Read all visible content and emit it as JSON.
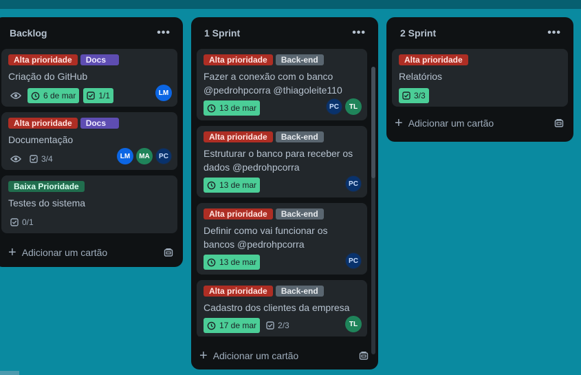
{
  "lists": [
    {
      "title": "Backlog",
      "menu": "•••",
      "add_card": "Adicionar um cartão",
      "cards": [
        {
          "labels": [
            {
              "text": "Alta prioridade",
              "color": "red"
            },
            {
              "text": "Docs",
              "color": "purple"
            }
          ],
          "title": "Criação do GitHub",
          "watch": true,
          "date": "6 de mar",
          "checklist": "1/1",
          "avatars": [
            "LM"
          ]
        },
        {
          "labels": [
            {
              "text": "Alta prioridade",
              "color": "red"
            },
            {
              "text": "Docs",
              "color": "purple"
            }
          ],
          "title": "Documentação",
          "watch": true,
          "checklist": "3/4",
          "avatars": [
            "LM",
            "MA",
            "PC"
          ]
        },
        {
          "labels": [
            {
              "text": "Baixa Prioridade",
              "color": "green"
            }
          ],
          "title": "Testes do sistema",
          "checklist": "0/1"
        }
      ]
    },
    {
      "title": "1 Sprint",
      "menu": "•••",
      "add_card": "Adicionar um cartão",
      "cards": [
        {
          "labels": [
            {
              "text": "Alta prioridade",
              "color": "red"
            },
            {
              "text": "Back-end",
              "color": "gray"
            }
          ],
          "title_lines": [
            "Fazer a conexão com o banco",
            "@pedrohpcorra @thiagoleite110"
          ],
          "date": "13 de mar",
          "avatars": [
            "PC",
            "TL"
          ]
        },
        {
          "labels": [
            {
              "text": "Alta prioridade",
              "color": "red"
            },
            {
              "text": "Back-end",
              "color": "gray"
            }
          ],
          "title_lines": [
            "Estruturar o banco para receber os",
            "dados @pedrohpcorra"
          ],
          "date": "13 de mar",
          "avatars": [
            "PC"
          ]
        },
        {
          "labels": [
            {
              "text": "Alta prioridade",
              "color": "red"
            },
            {
              "text": "Back-end",
              "color": "gray"
            }
          ],
          "title_lines": [
            "Definir como vai funcionar os",
            "bancos @pedrohpcorra"
          ],
          "date": "13 de mar",
          "avatars": [
            "PC"
          ]
        },
        {
          "labels": [
            {
              "text": "Alta prioridade",
              "color": "red"
            },
            {
              "text": "Back-end",
              "color": "gray"
            }
          ],
          "title_lines": [
            "Cadastro dos clientes da empresa"
          ],
          "date": "17 de mar",
          "checklist": "2/3",
          "avatars": [
            "TL"
          ]
        }
      ]
    },
    {
      "title": "2 Sprint",
      "menu": "•••",
      "add_card": "Adicionar um cartão",
      "cards": [
        {
          "labels": [
            {
              "text": "Alta prioridade",
              "color": "red"
            }
          ],
          "title": "Relatórios",
          "checklist": "3/3"
        }
      ]
    }
  ],
  "colors": {
    "board_bg": "#0a8aa0",
    "list_bg": "#0f1214",
    "card_bg": "#22272b",
    "badge_done": "#4bce97",
    "label_red": "#ae2e24",
    "label_purple": "#5e4db2",
    "label_gray": "#5a6670",
    "label_green": "#216e4e"
  }
}
